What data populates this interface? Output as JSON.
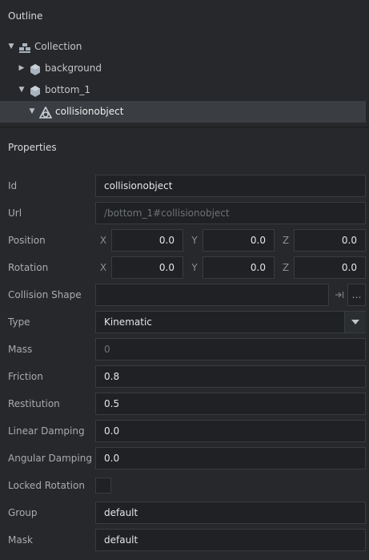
{
  "outline": {
    "title": "Outline",
    "tree": [
      {
        "label": "Collection",
        "icon": "collection-icon",
        "expanded": true
      },
      {
        "label": "background",
        "icon": "game-object-icon",
        "expanded": false
      },
      {
        "label": "bottom_1",
        "icon": "game-object-icon",
        "expanded": true
      },
      {
        "label": "collisionobject",
        "icon": "collision-object-icon",
        "expanded": true,
        "selected": true
      }
    ]
  },
  "properties": {
    "title": "Properties",
    "id": {
      "label": "Id",
      "value": "collisionobject"
    },
    "url": {
      "label": "Url",
      "value": "/bottom_1#collisionobject"
    },
    "position": {
      "label": "Position",
      "x_label": "X",
      "y_label": "Y",
      "z_label": "Z",
      "x": "0.0",
      "y": "0.0",
      "z": "0.0"
    },
    "rotation": {
      "label": "Rotation",
      "x_label": "X",
      "y_label": "Y",
      "z_label": "Z",
      "x": "0.0",
      "y": "0.0",
      "z": "0.0"
    },
    "collision_shape": {
      "label": "Collision Shape",
      "value": "",
      "clear_icon": "clear-icon",
      "browse_label": "…"
    },
    "type": {
      "label": "Type",
      "value": "Kinematic"
    },
    "mass": {
      "label": "Mass",
      "value": "0"
    },
    "friction": {
      "label": "Friction",
      "value": "0.8"
    },
    "restitution": {
      "label": "Restitution",
      "value": "0.5"
    },
    "linear_damping": {
      "label": "Linear Damping",
      "value": "0.0"
    },
    "angular_damping": {
      "label": "Angular Damping",
      "value": "0.0"
    },
    "locked_rotation": {
      "label": "Locked Rotation",
      "checked": false
    },
    "group": {
      "label": "Group",
      "value": "default"
    },
    "mask": {
      "label": "Mask",
      "value": "default"
    }
  },
  "colors": {
    "background": "#26282b",
    "selection": "#3a3d42",
    "field_bg": "#1f2124",
    "field_border": "#393c40"
  }
}
